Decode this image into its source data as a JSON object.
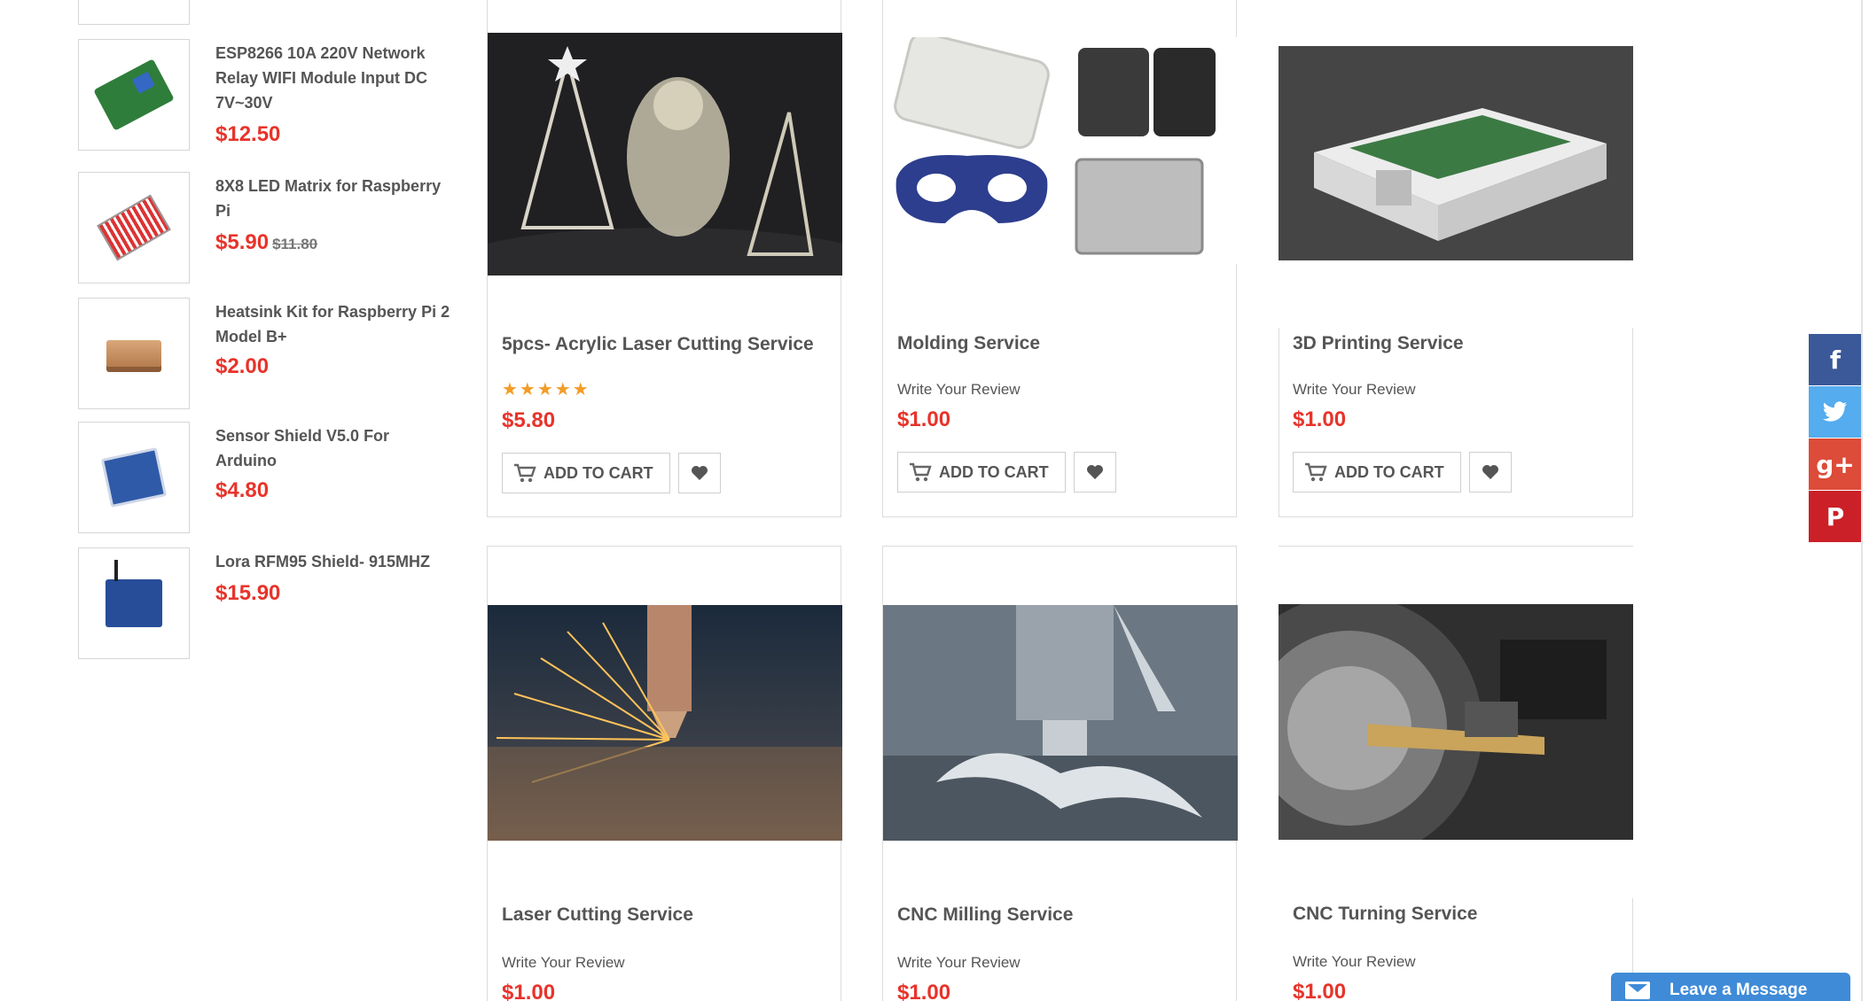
{
  "sidebar": {
    "items": [
      {
        "title": "ESP8266 10A 220V Network Relay WIFI Module Input DC 7V~30V",
        "price": "$12.50",
        "old_price": ""
      },
      {
        "title": "8X8 LED Matrix for Raspberry Pi",
        "price": "$5.90",
        "old_price": "$11.80"
      },
      {
        "title": "Heatsink Kit for Raspberry Pi 2 Model B+",
        "price": "$2.00",
        "old_price": ""
      },
      {
        "title": "Sensor Shield V5.0 For Arduino",
        "price": "$4.80",
        "old_price": ""
      },
      {
        "title": "Lora RFM95 Shield- 915MHZ",
        "price": "$15.90",
        "old_price": ""
      }
    ]
  },
  "products": [
    {
      "title": "5pcs- Acrylic Laser Cutting Service",
      "rating": "★★★★★",
      "review": "",
      "price": "$5.80",
      "cart_label": "ADD TO CART"
    },
    {
      "title": "Molding Service",
      "rating": "",
      "review": "Write Your Review",
      "price": "$1.00",
      "cart_label": "ADD TO CART"
    },
    {
      "title": "3D Printing Service",
      "rating": "",
      "review": "Write Your Review",
      "price": "$1.00",
      "cart_label": "ADD TO CART"
    },
    {
      "title": "Laser Cutting Service",
      "rating": "",
      "review": "Write Your Review",
      "price": "$1.00"
    },
    {
      "title": "CNC Milling Service",
      "rating": "",
      "review": "Write Your Review",
      "price": "$1.00"
    },
    {
      "title": "CNC Turning Service",
      "rating": "",
      "review": "Write Your Review",
      "price": "$1.00"
    }
  ],
  "social": {
    "facebook": "f",
    "twitter": "🐦",
    "googleplus": "g+",
    "pinterest": "P",
    "colors": {
      "facebook": "#3b5998",
      "twitter": "#55acee",
      "googleplus": "#dd4b39",
      "pinterest": "#cb2027"
    }
  },
  "chat": {
    "label": "Leave a Message"
  },
  "colors": {
    "price": "#e8332a",
    "stars": "#f39c26",
    "chat": "#3f8bd8"
  }
}
